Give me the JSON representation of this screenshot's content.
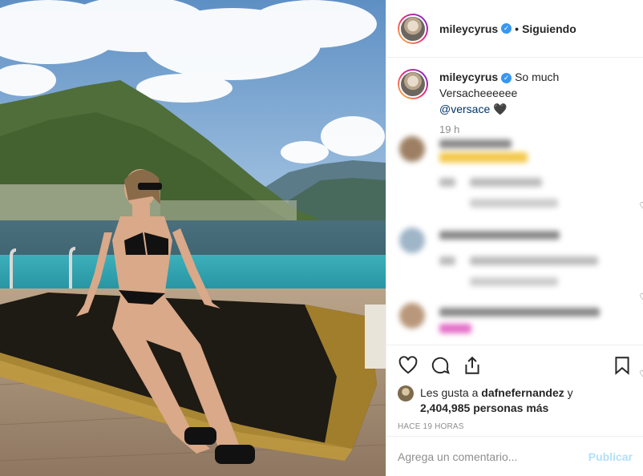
{
  "post": {
    "username": "mileycyrus",
    "follow_state": "Siguiendo",
    "separator": "•",
    "caption_text": "So much Versacheeeeee",
    "caption_mention": "@versace",
    "caption_emoji": "🖤",
    "time_short": "19 h",
    "likes_prefix": "Les gusta a",
    "likes_user": "dafnefernandez",
    "likes_and": "y",
    "likes_count": "2,404,985",
    "likes_suffix": "personas más",
    "time_long": "HACE 19 HORAS",
    "comment_placeholder": "Agrega un comentario...",
    "publish_label": "Publicar"
  },
  "icons": {
    "verified": "verified-badge",
    "like": "heart-icon",
    "comment": "comment-icon",
    "share": "share-icon",
    "save": "bookmark-icon"
  },
  "colors": {
    "link": "#003569",
    "verified": "#3897f0",
    "muted": "#8e8e8e",
    "publish_disabled": "#b2dffc"
  }
}
